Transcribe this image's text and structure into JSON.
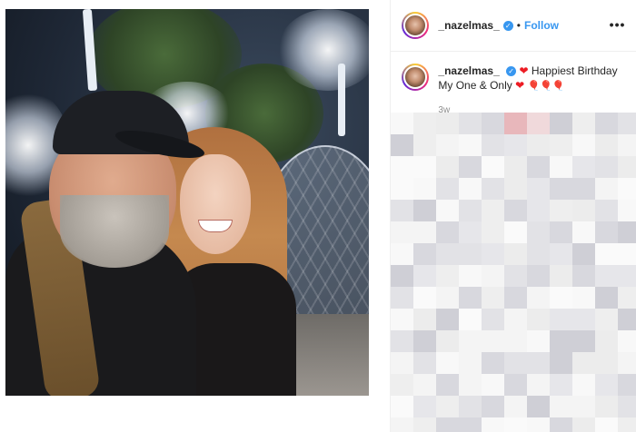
{
  "post": {
    "username": "_nazelmas_",
    "follow_label": "Follow",
    "dot": "•",
    "more_label": "•••",
    "caption": {
      "username": "_nazelmas_",
      "text_line1": "Happiest Birthday",
      "text_line2": "My One & Only",
      "heart": "❤",
      "balloon": "🎈",
      "time": "3w"
    }
  },
  "colors": {
    "accent": "#3897f0",
    "text": "#262626",
    "muted": "#8e8e8e",
    "heart": "#ed1c24"
  },
  "icons": [
    "verified-icon",
    "heart-icon",
    "balloon-icon",
    "more-options-icon"
  ]
}
